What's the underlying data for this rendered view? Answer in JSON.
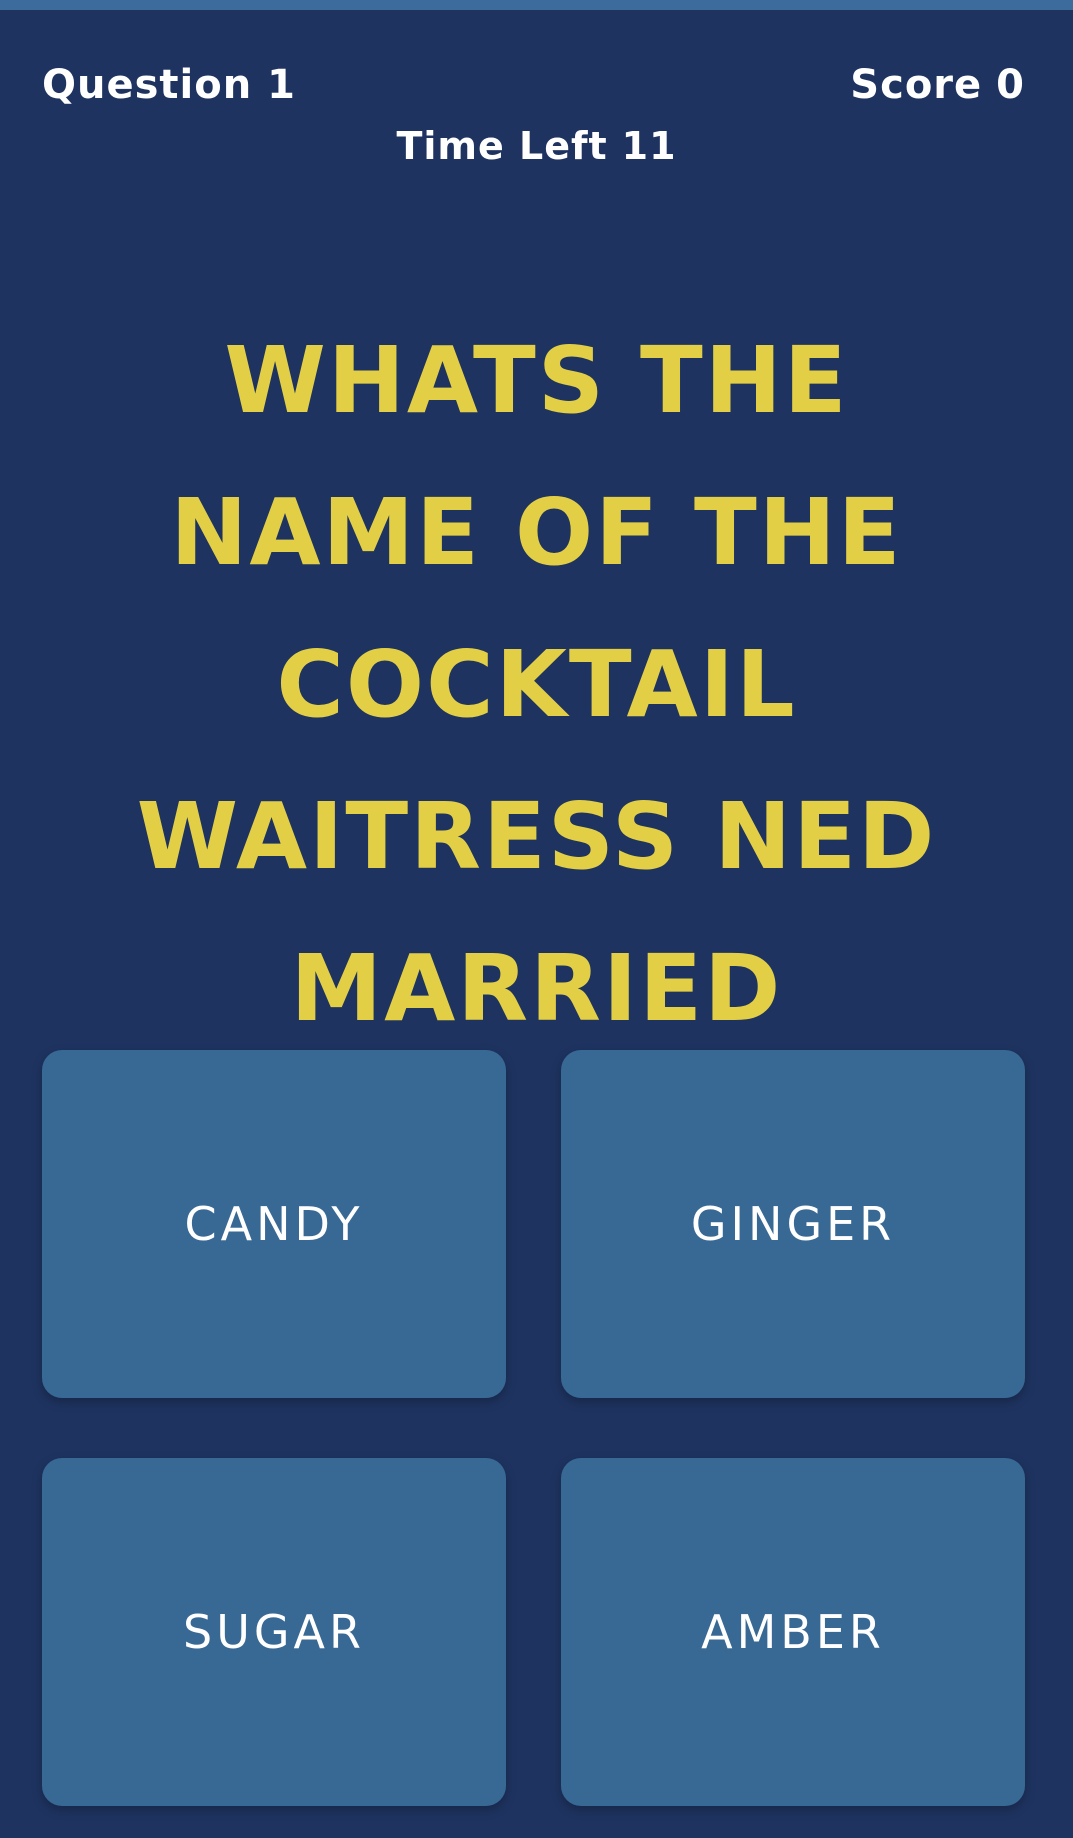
{
  "header": {
    "question_label": "Question 1",
    "score_label": "Score",
    "score_value": "0",
    "time_label": "Time Left",
    "time_value": "11"
  },
  "question": {
    "text": "Whats the name of the cocktail waitress Ned married"
  },
  "answers": [
    {
      "label": "CANDY"
    },
    {
      "label": "GINGER"
    },
    {
      "label": "SUGAR"
    },
    {
      "label": "AMBER"
    }
  ],
  "colors": {
    "background": "#1e3360",
    "question_text": "#e3cf45",
    "answer_button": "#386894",
    "top_bar": "#3d6b9c"
  }
}
